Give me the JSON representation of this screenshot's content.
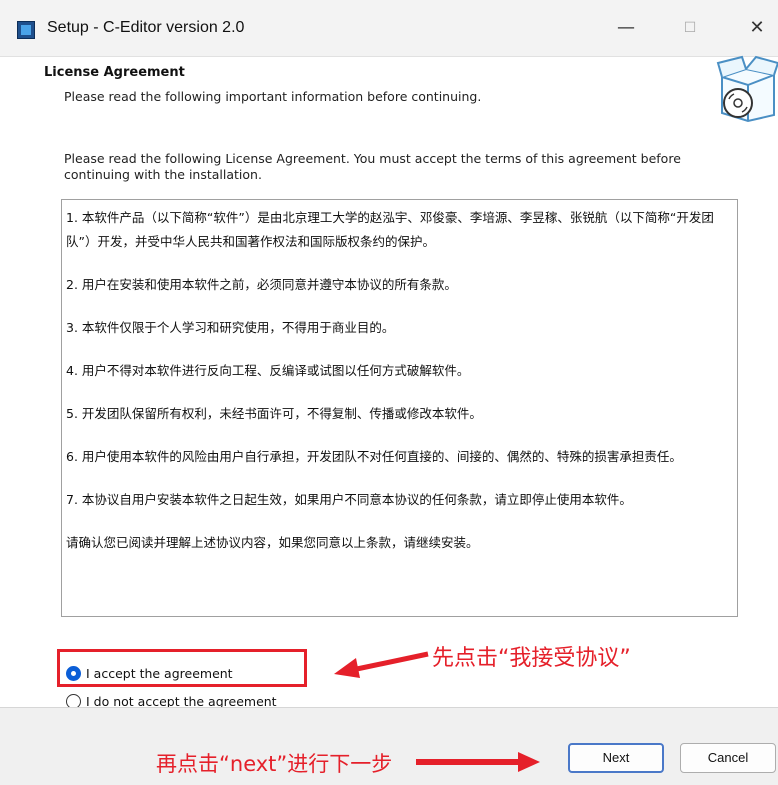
{
  "window": {
    "title": "Setup - C-Editor version 2.0",
    "minimize_glyph": "—",
    "maximize_glyph": "☐",
    "close_glyph": "✕"
  },
  "header": {
    "title": "License Agreement",
    "subtitle": "Please read the following important information before continuing.",
    "icon": "software-box-cd-icon"
  },
  "intro": "Please read the following License Agreement. You must accept the terms of this agreement before continuing with the installation.",
  "license": {
    "paragraphs": [
      "1. 本软件产品（以下简称“软件”）是由北京理工大学的赵泓宇、邓俊豪、李培源、李昱稼、张锐航（以下简称“开发团队”）开发，并受中华人民共和国著作权法和国际版权条约的保护。",
      "2. 用户在安装和使用本软件之前，必须同意并遵守本协议的所有条款。",
      "3. 本软件仅限于个人学习和研究使用，不得用于商业目的。",
      "4. 用户不得对本软件进行反向工程、反编译或试图以任何方式破解软件。",
      "5. 开发团队保留所有权利，未经书面许可，不得复制、传播或修改本软件。",
      "6. 用户使用本软件的风险由用户自行承担，开发团队不对任何直接的、间接的、偶然的、特殊的损害承担责任。",
      "7. 本协议自用户安装本软件之日起生效，如果用户不同意本协议的任何条款，请立即停止使用本软件。",
      "请确认您已阅读并理解上述协议内容，如果您同意以上条款，请继续安装。"
    ]
  },
  "options": {
    "accept": "I accept the agreement",
    "decline": "I do not accept the agreement",
    "selected": "accept"
  },
  "annotations": {
    "step1": "先点击“我接受协议”",
    "step2": "再点击“next”进行下一步",
    "color": "#e5202a"
  },
  "buttons": {
    "next": "Next",
    "cancel": "Cancel"
  }
}
